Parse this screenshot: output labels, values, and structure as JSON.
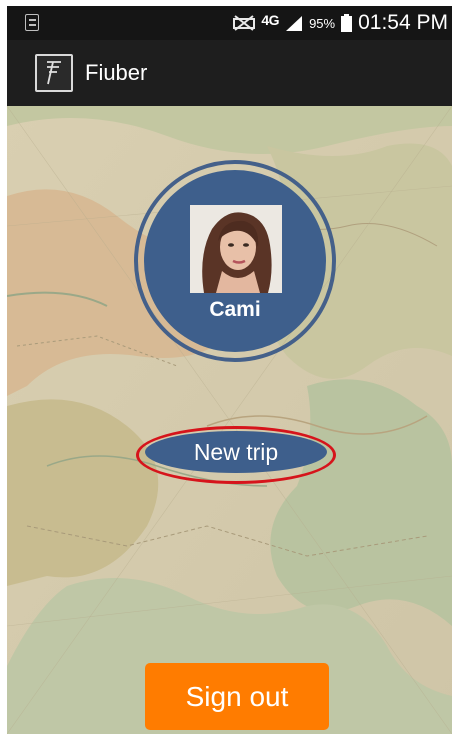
{
  "status_bar": {
    "network": "4G",
    "battery": "95%",
    "time": "01:54 PM",
    "icons": [
      "notification-icon",
      "mute-icon",
      "signal-icon",
      "battery-icon"
    ]
  },
  "app_bar": {
    "logo_icon": "fiuber-logo-icon",
    "title": "Fiuber"
  },
  "profile": {
    "name": "Cami",
    "avatar": "avatar-photo"
  },
  "actions": {
    "new_trip_label": "New trip",
    "sign_out_label": "Sign out"
  },
  "colors": {
    "status_bar": "#151515",
    "app_bar": "#1e1e1e",
    "profile_blue": "#3e5f8c",
    "highlight_red": "#d6141b",
    "sign_out_orange": "#ff7c00"
  }
}
